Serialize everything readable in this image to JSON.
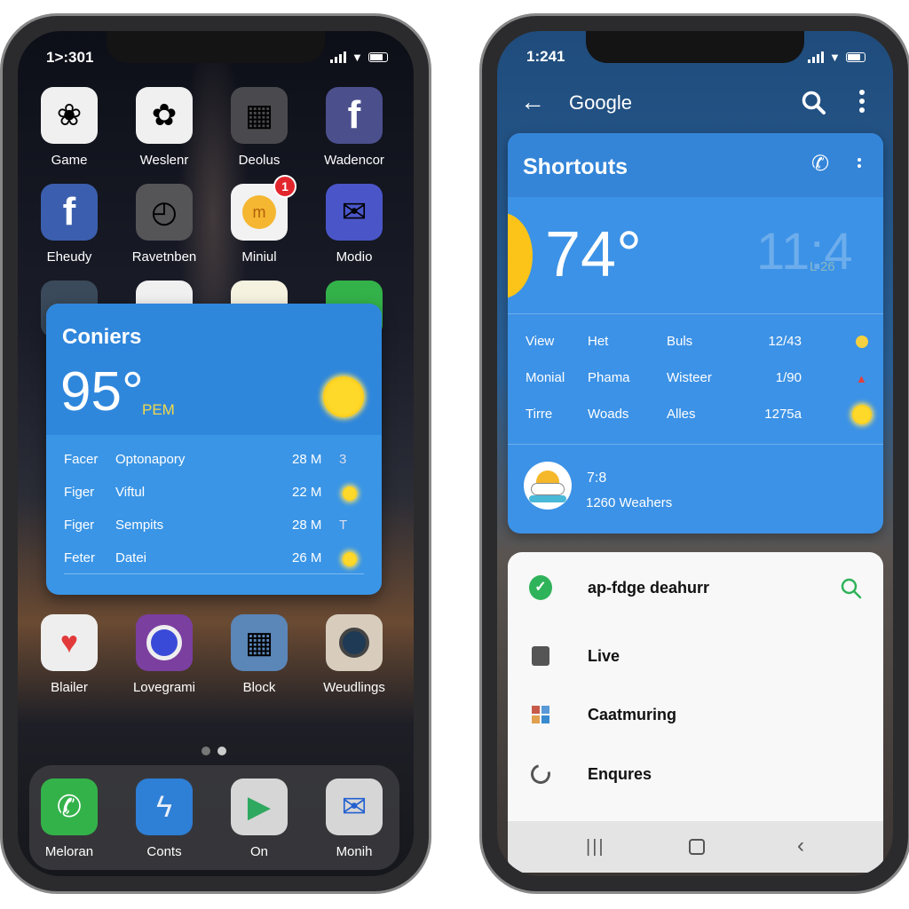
{
  "left_phone": {
    "status": {
      "time": "1>:301"
    },
    "apps": [
      {
        "label": "Game",
        "icon": "pinwheel-icon",
        "bg": "#f0f0f0"
      },
      {
        "label": "Weslenr",
        "icon": "photos-flower-icon",
        "bg": "#f0f0f0"
      },
      {
        "label": "Deolus",
        "icon": "folder-icon",
        "bg": "#4a4a4e"
      },
      {
        "label": "Wadencor",
        "icon": "facebook-icon",
        "bg": "#4b4f8c"
      },
      {
        "label": "Eheudy",
        "icon": "facebook-icon",
        "bg": "#3b5fae"
      },
      {
        "label": "Ravetnben",
        "icon": "timer-icon",
        "bg": "#555558"
      },
      {
        "label": "Miniul",
        "icon": "coin-icon",
        "bg": "#f2f2f2",
        "badge": "1"
      },
      {
        "label": "Modio",
        "icon": "mail-icon",
        "bg": "#4a56c8"
      }
    ],
    "apps_row4": [
      {
        "label": "Blailer",
        "icon": "heart-play-icon",
        "bg": "#eeeeee"
      },
      {
        "label": "Lovegrami",
        "icon": "camera-icon",
        "bg": "#7b3fa0"
      },
      {
        "label": "Block",
        "icon": "grid-icon",
        "bg": "#5b86b8"
      },
      {
        "label": "Weudlings",
        "icon": "instagram-camera-icon",
        "bg": "#d8cdbd"
      }
    ],
    "dock": [
      {
        "label": "Meloran",
        "icon": "phone-icon",
        "bg": "#34b24a"
      },
      {
        "label": "Conts",
        "icon": "bolt-icon",
        "bg": "#2e7fd6"
      },
      {
        "label": "On",
        "icon": "play-store-icon",
        "bg": "#d6d6d6"
      },
      {
        "label": "Monih",
        "icon": "envelope-icon",
        "bg": "#d6d6d6"
      }
    ],
    "widget": {
      "title": "Coniers",
      "temp": "95°",
      "unit": "PEM",
      "rows": [
        {
          "a": "Facer",
          "b": "Optonapory",
          "c": "28 M",
          "d": "3"
        },
        {
          "a": "Figer",
          "b": "Viftul",
          "c": "22 M",
          "d": ""
        },
        {
          "a": "Figer",
          "b": "Sempits",
          "c": "28 M",
          "d": "T"
        },
        {
          "a": "Feter",
          "b": "Datei",
          "c": "26 M",
          "d": ""
        }
      ]
    }
  },
  "right_phone": {
    "status": {
      "time": "1:241"
    },
    "toolbar": {
      "title": "Google"
    },
    "card": {
      "title": "Shortouts",
      "temp": "74°",
      "faded_time": "11:4",
      "faded_small": "L 26",
      "rows": [
        {
          "a": "View",
          "b": "Het",
          "c": "Buls",
          "d": "12/43"
        },
        {
          "a": "Monial",
          "b": "Phama",
          "c": "Wisteer",
          "d": "1/90"
        },
        {
          "a": "Tirre",
          "b": "Woads",
          "c": "Alles",
          "d": "1275a"
        }
      ],
      "footer_value": "7:8",
      "footer_label": "1260 Weahers"
    },
    "sheet": {
      "items": [
        {
          "label": "ap-fdge deahurr",
          "icon": "check-circle-icon"
        },
        {
          "label": "Live",
          "icon": "contact-card-icon"
        },
        {
          "label": "Caatmuring",
          "icon": "app-grid-icon"
        },
        {
          "label": "Enqures",
          "icon": "refresh-icon"
        }
      ]
    }
  },
  "colors": {
    "widget_blue": "#3a93e4",
    "success_green": "#2fb35a",
    "dark_blue_bg": "#1f4c7c"
  }
}
